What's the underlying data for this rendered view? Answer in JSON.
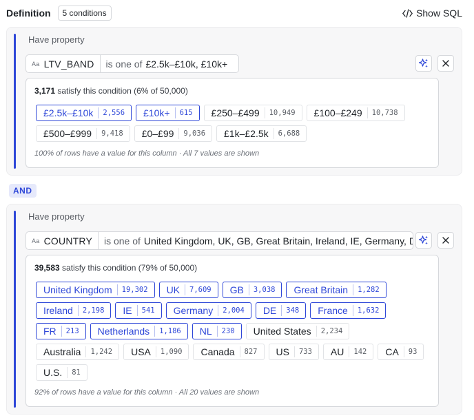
{
  "header": {
    "title": "Definition",
    "conditions_badge": "5 conditions",
    "show_sql_label": "Show SQL"
  },
  "connector": "AND",
  "conditions": [
    {
      "have_label": "Have property",
      "type_icon": "Aa",
      "property": "LTV_BAND",
      "operator": "is one of",
      "values_text": "£2.5k–£10k, £10k+",
      "satisfy_count": "3,171",
      "satisfy_text": "satisfy this condition (6% of 50,000)",
      "chips": [
        {
          "label": "£2.5k–£10k",
          "count": "2,556",
          "selected": true
        },
        {
          "label": "£10k+",
          "count": "615",
          "selected": true
        },
        {
          "label": "£250–£499",
          "count": "10,949",
          "selected": false
        },
        {
          "label": "£100–£249",
          "count": "10,738",
          "selected": false
        },
        {
          "label": "£500–£999",
          "count": "9,418",
          "selected": false
        },
        {
          "label": "£0–£99",
          "count": "9,036",
          "selected": false
        },
        {
          "label": "£1k–£2.5k",
          "count": "6,688",
          "selected": false
        }
      ],
      "footnote": "100% of rows have a value for this column · All 7 values are shown"
    },
    {
      "have_label": "Have property",
      "type_icon": "Aa",
      "property": "COUNTRY",
      "operator": "is one of",
      "values_text": "United Kingdom, UK, GB, Great Britain, Ireland, IE, Germany, DE, France, FR, Netherlands, NL",
      "satisfy_count": "39,583",
      "satisfy_text": "satisfy this condition (79% of 50,000)",
      "chips": [
        {
          "label": "United Kingdom",
          "count": "19,302",
          "selected": true
        },
        {
          "label": "UK",
          "count": "7,609",
          "selected": true
        },
        {
          "label": "GB",
          "count": "3,038",
          "selected": true
        },
        {
          "label": "Great Britain",
          "count": "1,282",
          "selected": true
        },
        {
          "label": "Ireland",
          "count": "2,198",
          "selected": true
        },
        {
          "label": "IE",
          "count": "541",
          "selected": true
        },
        {
          "label": "Germany",
          "count": "2,004",
          "selected": true
        },
        {
          "label": "DE",
          "count": "348",
          "selected": true
        },
        {
          "label": "France",
          "count": "1,632",
          "selected": true
        },
        {
          "label": "FR",
          "count": "213",
          "selected": true
        },
        {
          "label": "Netherlands",
          "count": "1,186",
          "selected": true
        },
        {
          "label": "NL",
          "count": "230",
          "selected": true
        },
        {
          "label": "United States",
          "count": "2,234",
          "selected": false
        },
        {
          "label": "Australia",
          "count": "1,242",
          "selected": false
        },
        {
          "label": "USA",
          "count": "1,090",
          "selected": false
        },
        {
          "label": "Canada",
          "count": "827",
          "selected": false
        },
        {
          "label": "US",
          "count": "733",
          "selected": false
        },
        {
          "label": "AU",
          "count": "142",
          "selected": false
        },
        {
          "label": "CA",
          "count": "93",
          "selected": false
        },
        {
          "label": "U.S.",
          "count": "81",
          "selected": false
        }
      ],
      "footnote": "92% of rows have a value for this column · All 20 values are shown"
    }
  ],
  "colors": {
    "accent": "#2e47d8",
    "card_bg": "#f7f7f8",
    "border": "#d6d8dc"
  }
}
